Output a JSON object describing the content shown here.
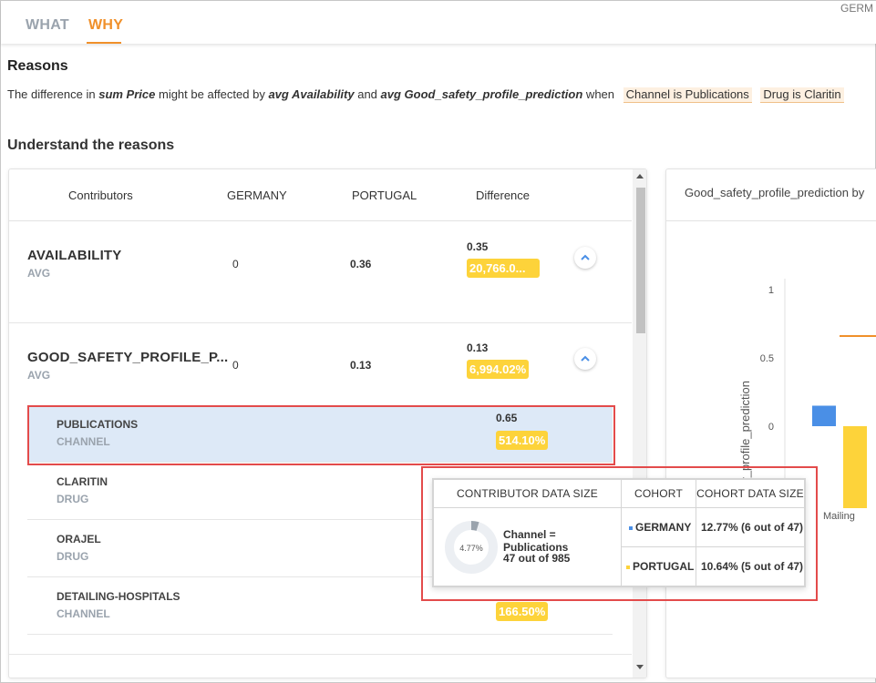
{
  "tabs": [
    {
      "label": "WHAT",
      "active": false
    },
    {
      "label": "WHY",
      "active": true
    }
  ],
  "corner_text": "GERM",
  "reasons": {
    "title": "Reasons",
    "sentence": {
      "p1": "The difference in ",
      "measure": "sum Price",
      "p2": " might be affected by ",
      "factor1": "avg Availability",
      "p3": " and ",
      "factor2": "avg Good_safety_profile_prediction",
      "p4": " when"
    },
    "chips": [
      "Channel is Publications",
      "Drug is Claritin"
    ]
  },
  "understand_title": "Understand the reasons",
  "table": {
    "headers": {
      "contributors": "Contributors",
      "germany": "GERMANY",
      "portugal": "PORTUGAL",
      "difference": "Difference"
    },
    "metrics": [
      {
        "name": "AVAILABILITY",
        "agg": "AVG",
        "germany": "0",
        "portugal": "0.36",
        "diff_value": "0.35",
        "diff_pct": "20,766.0..."
      },
      {
        "name": "GOOD_SAFETY_PROFILE_P...",
        "agg": "AVG",
        "germany": "0",
        "portugal": "0.13",
        "diff_value": "0.13",
        "diff_pct": "6,994.02%"
      }
    ],
    "sub_rows": [
      {
        "name": "PUBLICATIONS",
        "type": "CHANNEL",
        "diff_value": "0.65",
        "diff_pct": "514.10%"
      },
      {
        "name": "CLARITIN",
        "type": "DRUG"
      },
      {
        "name": "ORAJEL",
        "type": "DRUG"
      },
      {
        "name": "DETAILING-HOSPITALS",
        "type": "CHANNEL",
        "diff_pct": "166.50%"
      }
    ]
  },
  "right_panel": {
    "title": "Good_safety_profile_prediction by",
    "chart_data": {
      "type": "bar",
      "ylabel": "Good_safety_profile_prediction",
      "yticks": [
        "1",
        "0.5",
        "0"
      ],
      "categories": [
        "Mailing"
      ],
      "series": [
        {
          "name": "GERMANY",
          "color": "#4a8fe6",
          "values": [
            0.15
          ]
        },
        {
          "name": "PORTUGAL",
          "color": "#fdd33a",
          "values": [
            -0.6
          ]
        }
      ],
      "line_value": 0.66,
      "line_color": "#f0902a"
    }
  },
  "tooltip": {
    "headers": {
      "size": "CONTRIBUTOR DATA SIZE",
      "cohort": "COHORT",
      "cohort_size": "COHORT DATA SIZE"
    },
    "donut_label": "4.77%",
    "donut_fraction": 0.0477,
    "contributor": "Channel = Publications",
    "count": "47 out of 985",
    "cohorts": [
      {
        "name": "GERMANY",
        "color": "#4a8fe6",
        "size": "12.77% (6 out of 47)"
      },
      {
        "name": "PORTUGAL",
        "color": "#fdd33a",
        "size": "10.64% (5 out of 47)"
      }
    ]
  },
  "colors": {
    "accent": "#f0902a",
    "badge": "#fdd33a",
    "highlight": "#dde9f7",
    "callout": "#e34b4b"
  }
}
